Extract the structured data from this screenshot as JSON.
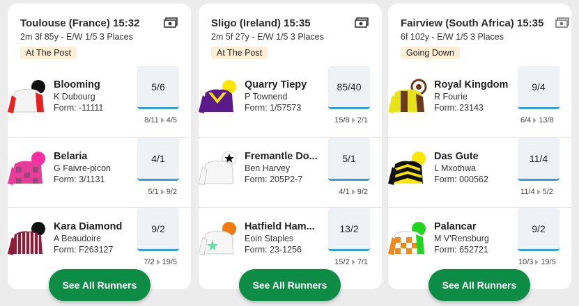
{
  "races": [
    {
      "title": "Toulouse (France) 15:32",
      "meta": "2m 3f 85y - E/W 1/5 3 Places",
      "status": "At The Post",
      "runners": [
        {
          "name": "Blooming",
          "jockey": "K Dubourg",
          "form": "Form: -11111",
          "odds": "5/6",
          "prev": "8/11",
          "now": "4/5"
        },
        {
          "name": "Belaria",
          "jockey": "G Faivre-picon",
          "form": "Form: 3/1131",
          "odds": "4/1",
          "prev": "5/1",
          "now": "9/2"
        },
        {
          "name": "Kara Diamond",
          "jockey": "A Beaudoire",
          "form": "Form: F263127",
          "odds": "9/2",
          "prev": "7/2",
          "now": "19/5"
        }
      ],
      "button": "See All Runners"
    },
    {
      "title": "Sligo (Ireland) 15:35",
      "meta": "2m 5f 27y - E/W 1/5 3 Places",
      "status": "At The Post",
      "runners": [
        {
          "name": "Quarry Tiepy",
          "jockey": "P Townend",
          "form": "Form: 1/57573",
          "odds": "85/40",
          "prev": "15/8",
          "now": "2/1"
        },
        {
          "name": "Fremantle Do...",
          "jockey": "Ben Harvey",
          "form": "Form: 205P2-7",
          "odds": "5/1",
          "prev": "4/1",
          "now": "9/2"
        },
        {
          "name": "Hatfield Ham...",
          "jockey": "Eoin Staples",
          "form": "Form: 23-1256",
          "odds": "13/2",
          "prev": "15/2",
          "now": "7/1"
        }
      ],
      "button": "See All Runners"
    },
    {
      "title": "Fairview (South Africa) 15:35",
      "meta": "6f 102y - E/W 1/5 3 Places",
      "status": "Going Down",
      "runners": [
        {
          "name": "Royal Kingdom",
          "jockey": "R Fourie",
          "form": "Form: 23143",
          "odds": "9/4",
          "prev": "6/4",
          "now": "13/8"
        },
        {
          "name": "Das Gute",
          "jockey": "L Mxothwa",
          "form": "Form: 000562",
          "odds": "11/4",
          "prev": "11/4",
          "now": "5/2"
        },
        {
          "name": "Palancar",
          "jockey": "M V'Rensburg",
          "form": "Form: 652721",
          "odds": "9/2",
          "prev": "10/3",
          "now": "19/5"
        }
      ],
      "button": "See All Runners"
    }
  ],
  "colors": {
    "button": "#0c8c45",
    "status_bg": "#fdefd6",
    "odds_bar": "#33a0d8"
  },
  "icons": {
    "race_header": "cash-icon",
    "runner": "jockey-silk-icon"
  }
}
